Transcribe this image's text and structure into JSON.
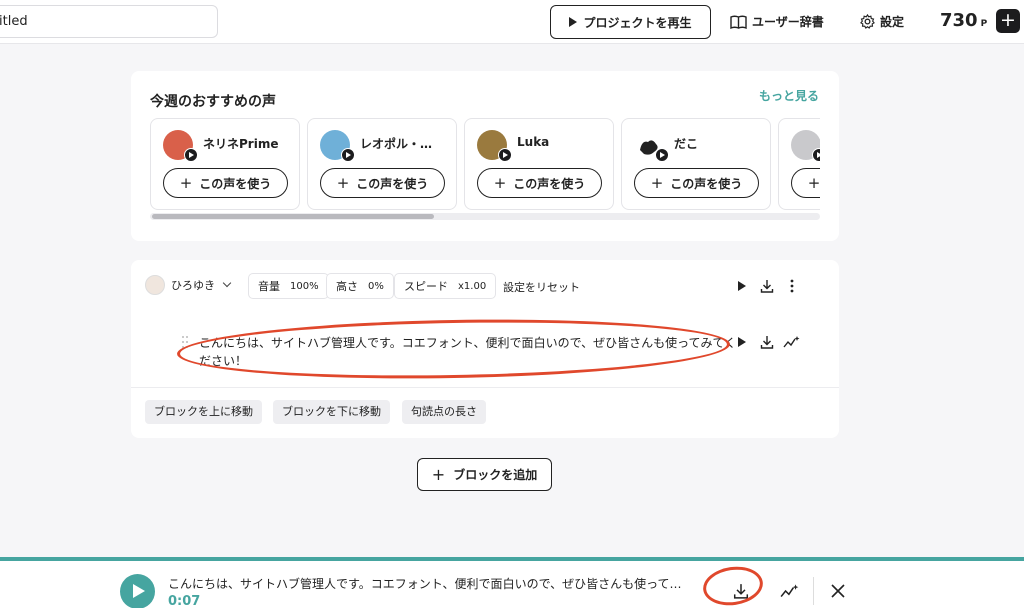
{
  "header": {
    "title_value": "itled",
    "play_project_label": "プロジェクトを再生",
    "dictionary_label": "ユーザー辞書",
    "settings_label": "設定",
    "points_value": "730",
    "points_unit": "P"
  },
  "recommend": {
    "title": "今週のおすすめの声",
    "more_label": "もっと見る",
    "use_label": "この声を使う",
    "voices": [
      {
        "name": "ネリネPrime",
        "color": "#d9604a"
      },
      {
        "name": "レオポル・…",
        "color": "#6fb0d8"
      },
      {
        "name": "Luka",
        "color": "#9a7a3e"
      },
      {
        "name": "だこ",
        "color": "#ffffff"
      },
      {
        "name": "",
        "color": "#c9c9cc"
      }
    ]
  },
  "block": {
    "speaker_name": "ひろゆき",
    "volume_label": "音量",
    "volume_value": "100%",
    "pitch_label": "高さ",
    "pitch_value": "0%",
    "speed_label": "スピード",
    "speed_value": "x1.00",
    "reset_label": "設定をリセット",
    "text": "こんにちは、サイトハブ管理人です。コエフォント、便利で面白いので、ぜひ皆さんも使ってみてください！",
    "actions": [
      "ブロックを上に移動",
      "ブロックを下に移動",
      "句読点の長さ"
    ]
  },
  "add_block_label": "ブロックを追加",
  "player": {
    "text": "こんにちは、サイトハブ管理人です。コエフォント、便利で面白いので、ぜひ皆さんも使って…",
    "time": "0:07"
  },
  "colors": {
    "accent": "#46a5a0",
    "annotation": "#e0482c"
  }
}
